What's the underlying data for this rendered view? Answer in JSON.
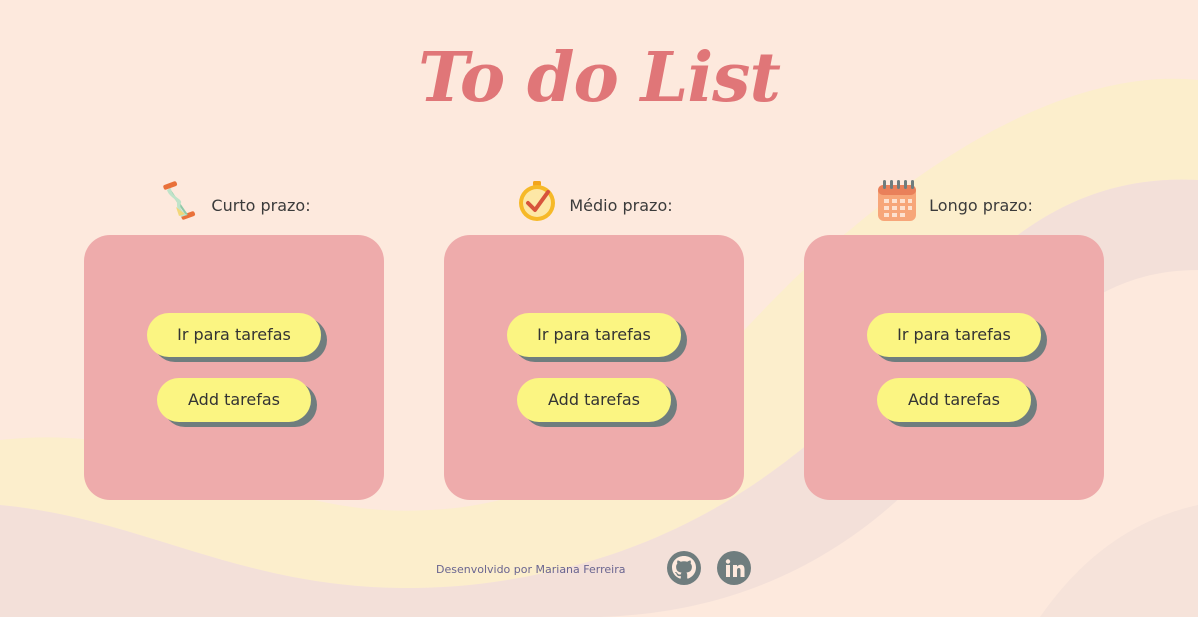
{
  "app": {
    "title": "To do List"
  },
  "columns": [
    {
      "heading": "Curto prazo:",
      "icon": "hourglass-icon",
      "go_label": "Ir para tarefas",
      "add_label": "Add tarefas"
    },
    {
      "heading": "Médio prazo:",
      "icon": "clock-check-icon",
      "go_label": "Ir para tarefas",
      "add_label": "Add tarefas"
    },
    {
      "heading": "Longo prazo:",
      "icon": "calendar-icon",
      "go_label": "Ir para tarefas",
      "add_label": "Add tarefas"
    }
  ],
  "footer": {
    "credit": "Desenvolvido por Mariana Ferreira",
    "links": [
      {
        "icon": "github-icon"
      },
      {
        "icon": "linkedin-icon"
      }
    ]
  },
  "colors": {
    "background": "#fde9dd",
    "title": "#e07678",
    "card": "#eeabab",
    "button": "#fbf582",
    "button_shadow": "#6f7d7e",
    "social": "#6f7d7e"
  }
}
